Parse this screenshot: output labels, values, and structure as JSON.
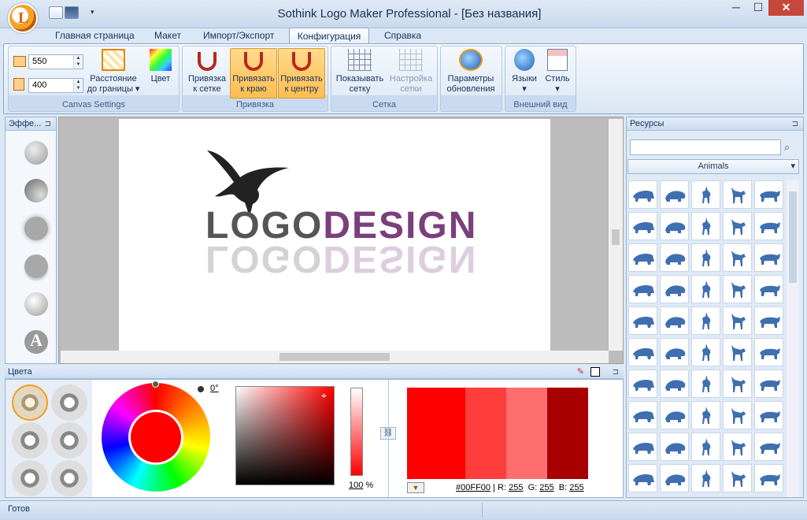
{
  "window": {
    "title": "Sothink Logo Maker Professional - [Без названия]",
    "minimize": "─",
    "maximize": "☐",
    "close": "✕"
  },
  "tabs": [
    "Главная страница",
    "Макет",
    "Импорт/Экспорт",
    "Конфигурация",
    "Справка"
  ],
  "active_tab": "Конфигурация",
  "ribbon": {
    "canvas_settings": {
      "label": "Canvas Settings",
      "width": "550",
      "height": "400",
      "margin_l1": "Расстояние",
      "margin_l2": "до границы",
      "color": "Цвет"
    },
    "snap": {
      "label": "Привязка",
      "grid_l1": "Привязка",
      "grid_l2": "к сетке",
      "edge_l1": "Привязать",
      "edge_l2": "к краю",
      "center_l1": "Привязать",
      "center_l2": "к центру"
    },
    "grid": {
      "label": "Сетка",
      "show_l1": "Показывать",
      "show_l2": "сетку",
      "settings_l1": "Настройка",
      "settings_l2": "сетки"
    },
    "update": {
      "l1": "Параметры",
      "l2": "обновления"
    },
    "view": {
      "label": "Внешний вид",
      "languages": "Языки",
      "style": "Стиль"
    }
  },
  "effects_panel": {
    "title": "Эффе...",
    "letter": "A"
  },
  "canvas": {
    "logo_part1": "LOGO",
    "logo_part2": "DESIGN"
  },
  "resources": {
    "title": "Ресурсы",
    "search_placeholder": "",
    "category": "Animals"
  },
  "colors": {
    "title": "Цвета",
    "angle": "0°",
    "alpha": "100",
    "alpha_unit": "%",
    "hex": "#00FF00",
    "r_label": "R:",
    "r": "255",
    "g_label": "G:",
    "g": "255",
    "b_label": "B:",
    "b": "255"
  },
  "swatches": [
    "#ff0000",
    "#ff3d3d",
    "#ff6e6e",
    "#a80000"
  ],
  "status": {
    "text": "Готов"
  }
}
